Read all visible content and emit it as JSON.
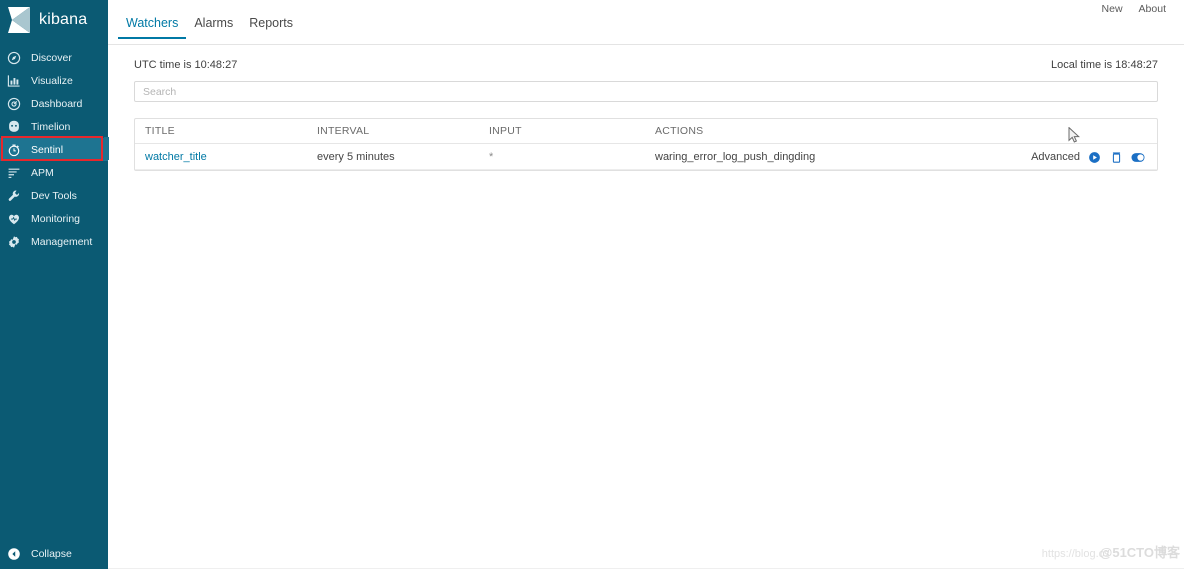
{
  "sidebar": {
    "brand": {
      "name": "kibana",
      "logo_icon": "kibana-logo-icon"
    },
    "items": [
      {
        "label": "Discover",
        "icon": "compass-icon",
        "active": false
      },
      {
        "label": "Visualize",
        "icon": "bar-chart-icon",
        "active": false
      },
      {
        "label": "Dashboard",
        "icon": "dashboard-icon",
        "active": false
      },
      {
        "label": "Timelion",
        "icon": "timelion-icon",
        "active": false
      },
      {
        "label": "Sentinl",
        "icon": "stopwatch-icon",
        "active": true
      },
      {
        "label": "APM",
        "icon": "apm-icon",
        "active": false
      },
      {
        "label": "Dev Tools",
        "icon": "wrench-icon",
        "active": false
      },
      {
        "label": "Monitoring",
        "icon": "heart-icon",
        "active": false
      },
      {
        "label": "Management",
        "icon": "gear-icon",
        "active": false
      }
    ],
    "collapse": {
      "label": "Collapse",
      "icon": "collapse-arrow-icon"
    },
    "colors": {
      "background": "#0b5a73",
      "active": "#1e7491",
      "annotation": "#e8272c"
    }
  },
  "topbar": {
    "tabs": [
      {
        "label": "Watchers",
        "active": true
      },
      {
        "label": "Alarms",
        "active": false
      },
      {
        "label": "Reports",
        "active": false
      }
    ],
    "links": [
      {
        "label": "New"
      },
      {
        "label": "About"
      }
    ],
    "accent_color": "#0079a5"
  },
  "main": {
    "utc_time": "UTC time is 10:48:27",
    "local_time": "Local time is 18:48:27",
    "search": {
      "value": "",
      "placeholder": "Search"
    },
    "table": {
      "columns": [
        "TITLE",
        "INTERVAL",
        "INPUT",
        "ACTIONS"
      ],
      "rows": [
        {
          "title": "watcher_title",
          "interval": "every 5 minutes",
          "input": "*",
          "actions": "waring_error_log_push_dingding",
          "row_controls": {
            "advanced_label": "Advanced",
            "icons": [
              "play-icon",
              "trash-icon",
              "toggle-on-icon"
            ]
          }
        }
      ]
    }
  },
  "watermark": {
    "url": "https://blog.cs",
    "brand": "@51CTO博客"
  }
}
